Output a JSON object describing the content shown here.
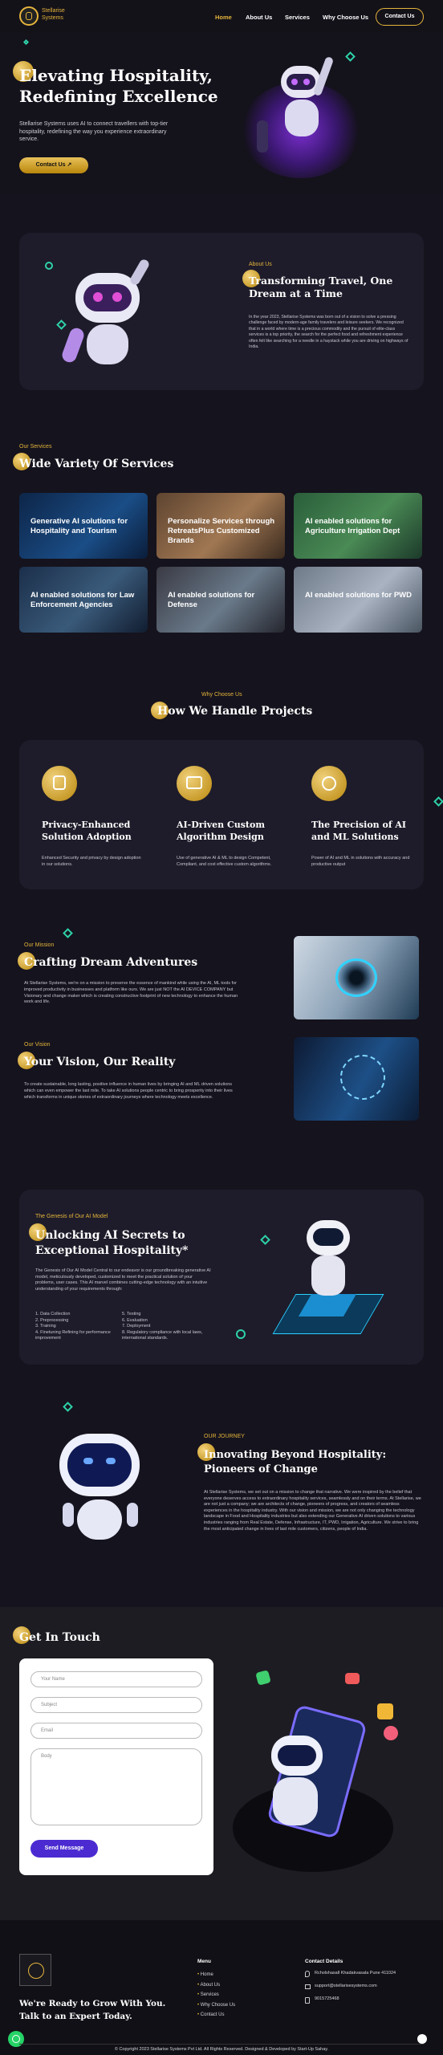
{
  "nav": {
    "brand_line1": "Stellarise",
    "brand_line2": "Systems",
    "items": [
      "Home",
      "About Us",
      "Services",
      "Why Choose Us"
    ],
    "contact": "Contact Us"
  },
  "hero": {
    "title_line1": "Elevating Hospitality,",
    "title_line2": "Redefining Excellence",
    "text": "Stellarise Systems uses AI to connect travellers with top-tier hospitality, redefining the way you experience extraordinary service.",
    "button": "Contact Us ↗"
  },
  "about": {
    "eyebrow": "About Us",
    "title": "Transforming Travel, One Dream at a Time",
    "text": "In the year 2023, Stellarise Systems was born out of a vision to solve a pressing challenge faced by modern-age family travelers and leisure seekers. We recognized that in a world where time is a precious commodity and the pursuit of elite-class services is a top priority, the search for the perfect food and refreshment experience often felt like searching for a needle in a haystack while you are driving on highways of India."
  },
  "services": {
    "eyebrow": "Our Services",
    "title": "Wide Variety Of Services",
    "items": [
      "Generative AI solutions for Hospitality and Tourism",
      "Personalize Services through RetreatsPlus Customized Brands",
      "AI enabled solutions for Agriculture Irrigation Dept",
      "AI enabled solutions for Law Enforcement Agencies",
      "AI enabled solutions for Defense",
      "AI enabled solutions for PWD"
    ]
  },
  "why": {
    "eyebrow": "Why Choose Us",
    "title": "How We Handle Projects",
    "cards": [
      {
        "title": "Privacy-Enhanced Solution Adoption",
        "text": "Enhanced Security and privacy by design adoption in our solutions."
      },
      {
        "title": "AI-Driven Custom Algorithm Design",
        "text": "Use of generative AI & ML to design Competent, Compliant, and cost effective custom algorithms."
      },
      {
        "title": "The Precision of AI and ML Solutions",
        "text": "Power of AI and ML in solutions with accuracy and productive output"
      }
    ]
  },
  "mission": {
    "eyebrow": "Our Mission",
    "title": "Crafting Dream Adventures",
    "text": "At Stellarise Systems, we're on a mission to preserve the essence of mankind while using the AI, ML tools for improved productivity in businesses and platform like ours. We are just NOT the AI DEVICE COMPANY but Visionary and change maker which is creating constructive footprint of new technology to enhance the human work and life."
  },
  "vision": {
    "eyebrow": "Our Vision",
    "title": "Your Vision, Our Reality",
    "text": "To create sustainable, long lasting, positive influence in human lives by bringing AI and ML driven solutions which can even empower the last mile. To take AI solutions people centric to bring prosperity into their lives which transforms in unique stories of extraordinary journeys where technology meets excellence."
  },
  "genesis": {
    "eyebrow": "The Genesis of Our AI Model",
    "title": "Unlocking AI Secrets to Exceptional Hospitality*",
    "text": "The Genesis of Our AI Model Central to our endeavor is our groundbreaking generative AI model, meticulously developed, customized to meet the practical solution of your problems, user cases. This AI marvel combines cutting-edge technology with an intuitive understanding of your requirements through:",
    "left_list": [
      "1. Data Collection",
      "2. Preprocessing",
      "3. Training",
      "4. Finetuning Refining for performance improvement"
    ],
    "right_list": [
      "5. Testing",
      "6. Evaluation",
      "7. Deployment",
      "8. Regulatory compliance with local laws, international standards."
    ]
  },
  "journey": {
    "eyebrow": "OUR JOURNEY",
    "title": "Innovating Beyond Hospitality: Pioneers of Change",
    "text": "At Stellarise Systems, we set out on a mission to change that narrative. We were inspired by the belief that everyone deserves access to extraordinary hospitality services, seamlessly and on their terms. At Stellarise, we are not just a company; we are architects of change, pioneers of progress, and creators of seamless experiences in the hospitality industry. With our vision and mission, we are not only changing the technology landscape in Food and Hospitality industries but also extending our Generative AI driven solutions to various industries ranging from Real Estate, Defense, Infrastructure, IT, PWD, Irrigation, Agriculture. We strive to bring the most anticipated change in lives of last mile customers, citizens, people of India."
  },
  "contact": {
    "title": "Get In Touch",
    "name_ph": "Your Name",
    "subject_ph": "Subject",
    "email_ph": "Email",
    "body_ph": "Body",
    "send": "Send Message"
  },
  "footer": {
    "tagline_line1": "We're Ready to Grow With You.",
    "tagline_line2": "Talk to an Expert Today.",
    "menu_title": "Menu",
    "menu": [
      "Home",
      "About Us",
      "Services",
      "Why Choose Us",
      "Contact Us"
    ],
    "details_title": "Contact Details",
    "address": "Rcholshasall Khadakvasala Pune 411024",
    "email": "support@stellarisesystems.com",
    "phone": "9015725468",
    "copyright": "© Copyright 2023 Stellarise Systems Pvt Ltd. All Rights Reserved. Designed & Developed by Start-Up Sahay."
  }
}
